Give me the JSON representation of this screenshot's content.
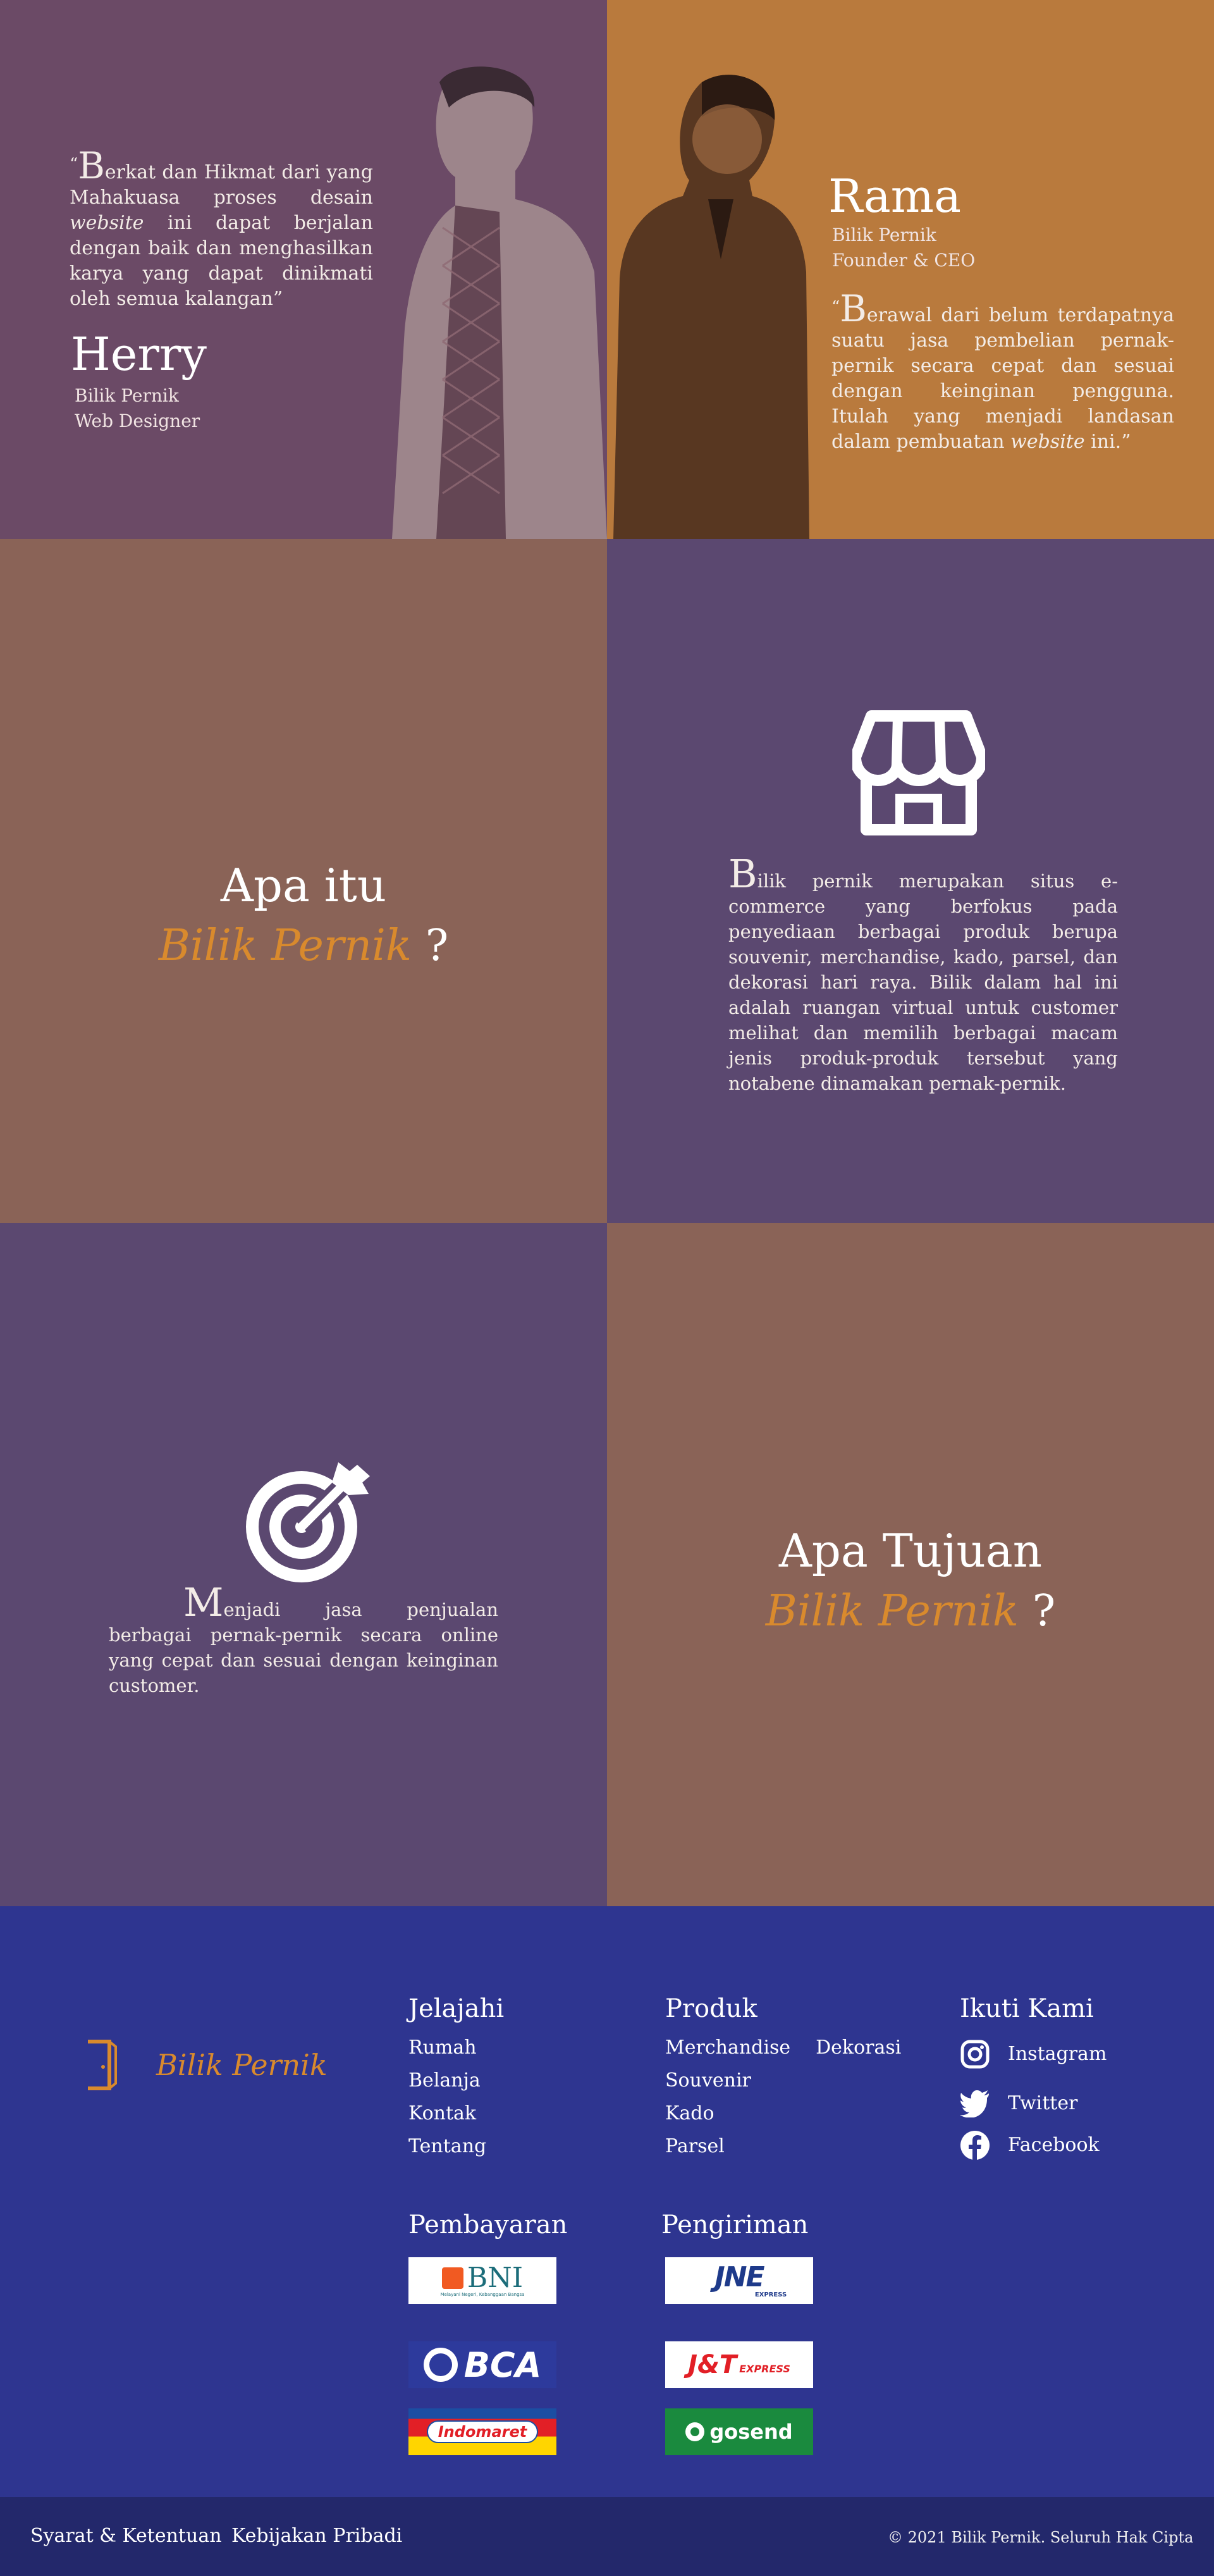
{
  "team": {
    "herry": {
      "quote_cap": "B",
      "quote_p1": "erkat dan Hikmat dari yang Mahakuasa proses desain ",
      "quote_em": "website",
      "quote_p2": " ini dapat berjalan dengan baik dan menghasilkan karya yang dapat dinikmati oleh semua kalangan”",
      "open_quote": "“",
      "name": "Herry",
      "company": "Bilik Pernik",
      "role": "Web Designer"
    },
    "rama": {
      "name": "Rama",
      "company": "Bilik Pernik",
      "role": "Founder & CEO",
      "open_quote": "“",
      "quote_cap": "B",
      "quote_p1": "erawal dari belum terdapatnya suatu jasa pembelian pernak-pernik secara cepat dan sesuai dengan keinginan pengguna. Itulah yang menjadi landasan dalam pembuatan ",
      "quote_em": "website",
      "quote_p2": " ini.”"
    }
  },
  "about": {
    "title_line1": "Apa itu",
    "brand": "Bilik Pernik",
    "qmark": "?",
    "icon": "store-icon",
    "para_cap": "B",
    "para_rest": "ilik pernik merupakan situs e-commerce yang berfokus pada penyediaan berbagai produk berupa souvenir, merchandise, kado, parsel, dan dekorasi hari raya. Bilik dalam hal ini adalah ruangan virtual untuk customer melihat dan memilih berbagai macam jenis produk-produk tersebut yang notabene dinamakan pernak-pernik."
  },
  "goal": {
    "icon": "target-icon",
    "para_cap": "M",
    "para_rest": "enjadi jasa penjualan berbagai pernak-pernik secara online yang  cepat dan sesuai dengan keinginan customer.",
    "title_line1": "Apa Tujuan",
    "brand": "Bilik Pernik",
    "qmark": "?"
  },
  "footer": {
    "logo_text": "Bilik Pernik",
    "explore": {
      "title": "Jelajahi",
      "links": [
        "Rumah",
        "Belanja",
        "Kontak",
        "Tentang"
      ]
    },
    "products": {
      "title": "Produk",
      "links": [
        "Merchandise",
        "Dekorasi",
        "Souvenir",
        "Kado",
        "Parsel"
      ]
    },
    "follow": {
      "title": "Ikuti Kami",
      "links": [
        "Instagram",
        "Twitter",
        "Facebook"
      ]
    },
    "payment": {
      "title": "Pembayaran",
      "bni": "BNI",
      "bni_tag": "Melayani Negeri, Kebanggaan Bangsa",
      "bca": "BCA",
      "indomaret": "Indomaret"
    },
    "shipping": {
      "title": "Pengiriman",
      "jne": "JNE",
      "jne_tag": "EXPRESS",
      "jnt": "J&T",
      "jnt_tag": "EXPRESS",
      "gosend": "gosend"
    }
  },
  "bottombar": {
    "terms": "Syarat & Ketentuan",
    "privacy": "Kebijakan Pribadi",
    "copyright": "© 2021 Bilik Pernik. Seluruh Hak Cipta"
  },
  "colors": {
    "accent": "#d98a2d",
    "footer_bg": "#2e3590",
    "bottombar_bg": "#23286b"
  }
}
